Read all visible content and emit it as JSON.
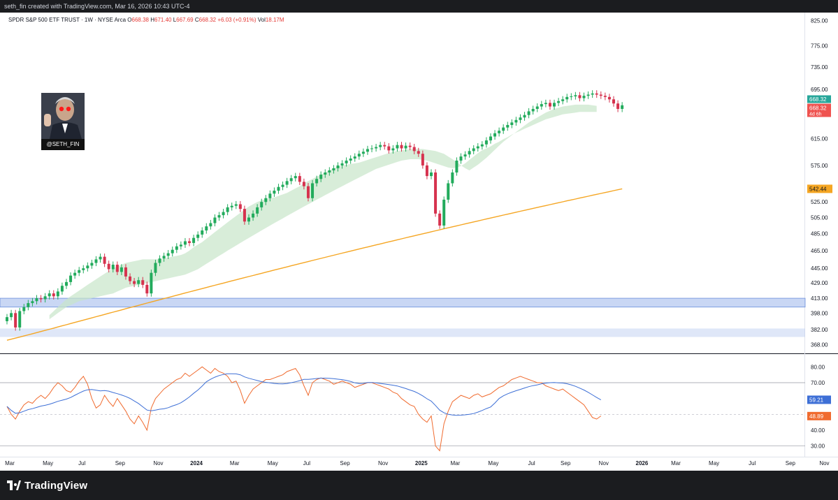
{
  "header": {
    "caption": "seth_fin created with TradingView.com, Mar 16, 2026 10:43 UTC-4"
  },
  "legend": {
    "symbol": "SPDR S&P 500 ETF TRUST · 1W · NYSE Arca",
    "open_label": "O",
    "open": "668.38",
    "high_label": "H",
    "high": "671.40",
    "low_label": "L",
    "low": "667.69",
    "close_label": "C",
    "close": "668.32",
    "change": "+6.03 (+0.91%)",
    "vol_label": "Vol",
    "vol": "18.17M"
  },
  "avatar": {
    "handle": "@SETH_FIN"
  },
  "footer": {
    "brand": "TradingView"
  },
  "colors": {
    "up": "#26a69a",
    "down": "#ef5350",
    "up_candle": "#22ab5c",
    "down_candle": "#d6324e",
    "ma200": "#f5a623",
    "band": "#c8e6c9",
    "rsi": "#f06b2f",
    "rsi_ma": "#3d6fd6",
    "zone": "#b7c9f0"
  },
  "chart_data": [
    {
      "type": "candlestick",
      "title": "SPDR S&P 500 ETF TRUST · 1W · NYSE Arca",
      "y_scale": "log",
      "ylim": [
        360,
        830
      ],
      "price_ticks": [
        "825.00",
        "775.00",
        "735.00",
        "695.00",
        "655.00",
        "615.00",
        "575.00",
        "542.44",
        "525.00",
        "505.00",
        "485.00",
        "465.00",
        "445.00",
        "429.00",
        "413.00",
        "398.00",
        "382.00",
        "368.00"
      ],
      "price_tick_values": [
        825,
        775,
        735,
        695,
        655,
        615,
        575,
        542.44,
        525,
        505,
        485,
        465,
        445,
        429,
        413,
        398,
        382,
        368
      ],
      "x_tick_labels": [
        "Mar",
        "May",
        "Jul",
        "Sep",
        "Nov",
        "2024",
        "Mar",
        "May",
        "Jul",
        "Sep",
        "Nov",
        "2025",
        "Mar",
        "May",
        "Jul",
        "Sep",
        "Nov",
        "2026",
        "Mar",
        "May",
        "Jul",
        "Sep",
        "Nov"
      ],
      "x_tick_weeks": [
        0,
        9,
        17,
        26,
        35,
        44,
        53,
        62,
        70,
        79,
        88,
        97,
        105,
        114,
        123,
        131,
        140,
        149,
        157,
        166,
        175,
        184,
        192
      ],
      "last_price": 668.32,
      "last_price_labels": [
        "668.32",
        "668.32"
      ],
      "countdown": "4d 6h",
      "ma200_last": 542.44,
      "ma200_last_label": "542.44",
      "closes": [
        394,
        398,
        384,
        400,
        404,
        408,
        410,
        413,
        412,
        415,
        418,
        415,
        420,
        426,
        430,
        437,
        440,
        443,
        445,
        448,
        451,
        455,
        458,
        450,
        444,
        449,
        441,
        446,
        436,
        431,
        428,
        432,
        427,
        418,
        440,
        451,
        456,
        459,
        462,
        466,
        470,
        472,
        476,
        474,
        480,
        484,
        489,
        494,
        498,
        505,
        508,
        512,
        518,
        520,
        522,
        516,
        500,
        505,
        510,
        518,
        525,
        530,
        536,
        540,
        545,
        548,
        553,
        557,
        560,
        552,
        546,
        530,
        550,
        556,
        562,
        565,
        568,
        571,
        575,
        578,
        582,
        585,
        588,
        592,
        595,
        599,
        600,
        602,
        605,
        603,
        597,
        600,
        605,
        600,
        604,
        602,
        596,
        592,
        575,
        560,
        565,
        510,
        495,
        528,
        550,
        565,
        582,
        588,
        591,
        596,
        600,
        603,
        606,
        612,
        618,
        623,
        627,
        632,
        636,
        640,
        644,
        648,
        652,
        658,
        662,
        666,
        670,
        672,
        666,
        672,
        675,
        678,
        682,
        683,
        685,
        680,
        684,
        686,
        688,
        686,
        684,
        682,
        678,
        671,
        662,
        668
      ],
      "band_upper": [
        396,
        400,
        404,
        408,
        412,
        415,
        418,
        421,
        424,
        427,
        430,
        433,
        436,
        439,
        442,
        445,
        447,
        449,
        451,
        452,
        453,
        454,
        455,
        455,
        455,
        455,
        455,
        456,
        457,
        458,
        459,
        460,
        462,
        465,
        469,
        472,
        475,
        479,
        483,
        487,
        491,
        495,
        499,
        503,
        507,
        511,
        515,
        519,
        522,
        525,
        527,
        529,
        530,
        531,
        533,
        535,
        537,
        540,
        543,
        546,
        550,
        553,
        556,
        559,
        562,
        565,
        568,
        571,
        573,
        575,
        576,
        577,
        578,
        579,
        581,
        583,
        585,
        587,
        589,
        591,
        593,
        595,
        596,
        597,
        598,
        599,
        599,
        599,
        599,
        598,
        597,
        596,
        594,
        592,
        588,
        584,
        580,
        575,
        571,
        568,
        572,
        576,
        581,
        586,
        592,
        598,
        604,
        610,
        615,
        620,
        625,
        630,
        635,
        640,
        644,
        648,
        652,
        656,
        659,
        662,
        664,
        666,
        667,
        668,
        669,
        669,
        669,
        669,
        668,
        667
      ],
      "band_lower": [
        392,
        395,
        398,
        401,
        404,
        406,
        408,
        410,
        411,
        412,
        413,
        414,
        415,
        416,
        417,
        418,
        420,
        422,
        424,
        425,
        426,
        427,
        428,
        429,
        430,
        431,
        432,
        433,
        434,
        435,
        436,
        437,
        438,
        440,
        442,
        444,
        447,
        450,
        453,
        456,
        459,
        462,
        465,
        468,
        471,
        474,
        477,
        480,
        483,
        486,
        489,
        492,
        495,
        498,
        501,
        504,
        507,
        510,
        513,
        516,
        519,
        522,
        525,
        528,
        531,
        534,
        537,
        540,
        543,
        546,
        549,
        552,
        555,
        558,
        561,
        564,
        567,
        570,
        572,
        574,
        576,
        578,
        580,
        582,
        583,
        584,
        584,
        584,
        583,
        582,
        580,
        578,
        576,
        574,
        572,
        571,
        572,
        574,
        578,
        583,
        588,
        593,
        597,
        600,
        603,
        607,
        610,
        614,
        617,
        621,
        624,
        627,
        630,
        633,
        636,
        639,
        642,
        645,
        647,
        649,
        651,
        653,
        654,
        655,
        656,
        657,
        657,
        657,
        657,
        657
      ],
      "band_start_week": 10,
      "ma200_start": 372,
      "ma200_end": 542.44
    },
    {
      "type": "line",
      "title": "RSI",
      "ylim": [
        25,
        85
      ],
      "ticks": [
        "80.00",
        "70.00",
        "40.00",
        "30.00"
      ],
      "tick_values": [
        80,
        70,
        40,
        30
      ],
      "levels": [
        70,
        50,
        30
      ],
      "rsi_last": 48.89,
      "rsi_last_label": "48.89",
      "rsi_ma_last": 59.21,
      "rsi_ma_last_label": "59.21",
      "series": [
        {
          "role": "rsi",
          "values": [
            55,
            50,
            47,
            52,
            56,
            58,
            57,
            60,
            62,
            60,
            63,
            67,
            70,
            68,
            65,
            64,
            67,
            71,
            74,
            69,
            60,
            54,
            56,
            62,
            58,
            55,
            60,
            56,
            52,
            47,
            44,
            49,
            45,
            40,
            54,
            60,
            63,
            66,
            68,
            70,
            72,
            73,
            76,
            74,
            76,
            78,
            80,
            78,
            76,
            79,
            77,
            76,
            74,
            70,
            71,
            65,
            57,
            62,
            66,
            68,
            70,
            72,
            72,
            73,
            74,
            75,
            77,
            78,
            79,
            75,
            68,
            62,
            70,
            72,
            73,
            72,
            71,
            69,
            70,
            71,
            70,
            69,
            67,
            68,
            69,
            70,
            70,
            69,
            68,
            67,
            66,
            64,
            63,
            60,
            58,
            56,
            55,
            50,
            47,
            45,
            49,
            30,
            27,
            44,
            52,
            58,
            60,
            62,
            61,
            60,
            62,
            63,
            61,
            62,
            63,
            65,
            67,
            68,
            70,
            72,
            73,
            74,
            73,
            72,
            71,
            70,
            70,
            68,
            67,
            66,
            65,
            66,
            64,
            62,
            60,
            58,
            56,
            52,
            48,
            47,
            49
          ],
          "draw_values": []
        },
        {
          "role": "rsi_ma",
          "values": []
        }
      ]
    }
  ]
}
